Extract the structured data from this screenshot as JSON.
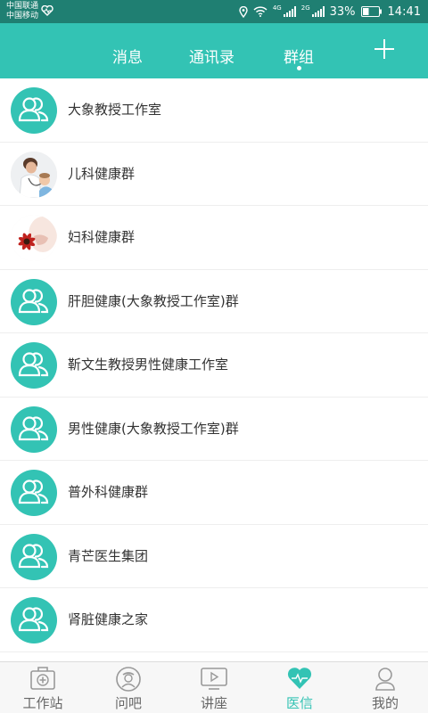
{
  "status_bar": {
    "carrier1": "中国联通",
    "carrier2": "中国移动",
    "net4g": "4G",
    "net2g": "2G",
    "battery": "33%",
    "time": "14:41"
  },
  "header": {
    "tabs": [
      {
        "label": "消息"
      },
      {
        "label": "通讯录"
      },
      {
        "label": "群组",
        "active": true
      }
    ],
    "add_icon": "plus-icon"
  },
  "groups": [
    {
      "name": "大象教授工作室",
      "avatar": "group-avatar-icon"
    },
    {
      "name": "儿科健康群",
      "avatar": "pediatric-photo"
    },
    {
      "name": "妇科健康群",
      "avatar": "flower-photo"
    },
    {
      "name": "肝胆健康(大象教授工作室)群",
      "avatar": "group-avatar-icon"
    },
    {
      "name": "靳文生教授男性健康工作室",
      "avatar": "group-avatar-icon"
    },
    {
      "name": "男性健康(大象教授工作室)群",
      "avatar": "group-avatar-icon"
    },
    {
      "name": "普外科健康群",
      "avatar": "group-avatar-icon"
    },
    {
      "name": "青芒医生集团",
      "avatar": "group-avatar-icon"
    },
    {
      "name": "肾脏健康之家",
      "avatar": "group-avatar-icon"
    }
  ],
  "bottom_nav": [
    {
      "label": "工作站",
      "icon": "medical-kit-icon"
    },
    {
      "label": "问吧",
      "icon": "doctor-icon"
    },
    {
      "label": "讲座",
      "icon": "video-icon"
    },
    {
      "label": "医信",
      "icon": "heart-icon",
      "active": true
    },
    {
      "label": "我的",
      "icon": "person-icon"
    }
  ],
  "colors": {
    "accent": "#33c3b4",
    "status_bar": "#1f7f72"
  }
}
